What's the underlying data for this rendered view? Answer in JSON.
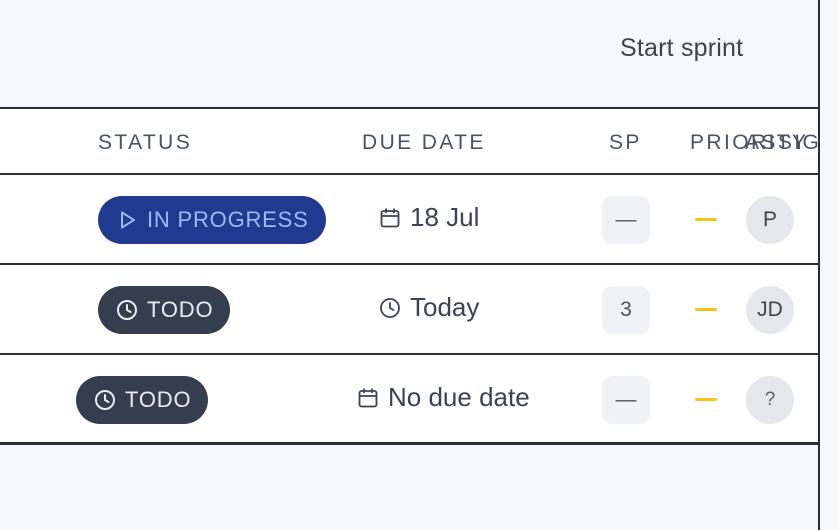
{
  "toolbar": {
    "start_sprint_label": "Start sprint"
  },
  "table": {
    "headers": {
      "status": "STATUS",
      "due_date": "DUE DATE",
      "sp": "SP",
      "priority": "PRIORITY",
      "assignee": "ASSIGNEE"
    },
    "rows": [
      {
        "status": "IN PROGRESS",
        "status_icon": "play-icon",
        "due": "18 Jul",
        "due_icon": "calendar-icon",
        "sp": "—",
        "priority": "medium",
        "assignee_initials": "P"
      },
      {
        "status": "TODO",
        "status_icon": "clock-icon",
        "due": "Today",
        "due_icon": "clock-icon",
        "sp": "3",
        "priority": "medium",
        "assignee_initials": "JD"
      },
      {
        "status": "TODO",
        "status_icon": "clock-icon",
        "due": "No due date",
        "due_icon": "calendar-icon",
        "sp": "—",
        "priority": "medium",
        "assignee_initials": "?"
      }
    ]
  },
  "colors": {
    "in_progress_bg": "#1f3a8f",
    "in_progress_text": "#9fb8ff",
    "todo_bg": "#353e4e",
    "todo_text": "#e9ecf2",
    "priority_medium": "#f5c518"
  }
}
